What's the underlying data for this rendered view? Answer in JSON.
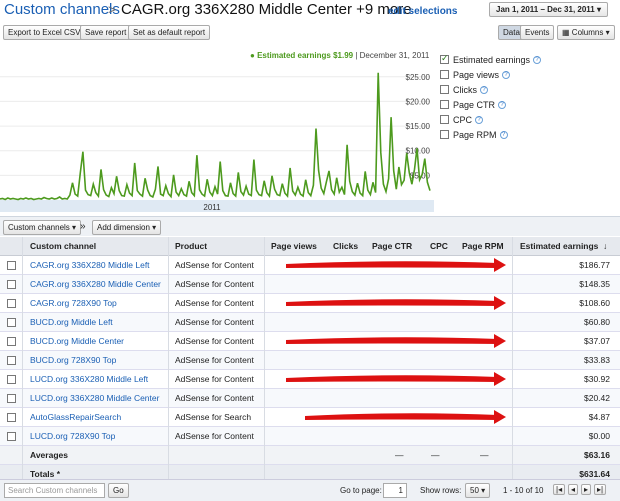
{
  "breadcrumb": {
    "parent": "Custom channels",
    "separator": ">",
    "current": "CAGR.org 336X280 Middle Center +9 more",
    "edit": "edit selections"
  },
  "date_range": "Jan 1, 2011 – Dec 31, 2011",
  "toolbar": {
    "export": "Export to Excel CSV",
    "save": "Save report",
    "default": "Set as default report"
  },
  "view_toggle": {
    "data": "Data",
    "events": "Events",
    "columns": "Columns"
  },
  "legend": {
    "series": "Estimated earnings $1.99",
    "date": "December 31, 2011"
  },
  "metrics": [
    {
      "label": "Estimated earnings",
      "checked": true
    },
    {
      "label": "Page views",
      "checked": false
    },
    {
      "label": "Clicks",
      "checked": false
    },
    {
      "label": "Page CTR",
      "checked": false
    },
    {
      "label": "CPC",
      "checked": false
    },
    {
      "label": "Page RPM",
      "checked": false
    }
  ],
  "chart_data": {
    "type": "line",
    "xlabel": "2011",
    "y_ticks": [
      "$25.00",
      "$20.00",
      "$15.00",
      "$10.00",
      "$5.00"
    ],
    "ylim": [
      0,
      28
    ],
    "series_color": "#4d9a1e",
    "values": [
      0.2,
      0.3,
      0.1,
      0.4,
      0.2,
      0.3,
      0.2,
      0.1,
      0.3,
      0.2,
      0.4,
      0.2,
      0.3,
      0.1,
      0.2,
      0.3,
      0.2,
      0.5,
      0.3,
      0.2,
      0.4,
      0.2,
      0.3,
      0.6,
      0.2,
      0.3,
      0.2,
      1.0,
      3.5,
      1.2,
      0.8,
      5.5,
      9.8,
      2.0,
      1.1,
      0.9,
      3.2,
      1.5,
      0.8,
      6.2,
      2.1,
      1.0,
      0.7,
      2.5,
      1.3,
      4.8,
      1.9,
      0.9,
      0.8,
      3.1,
      1.4,
      0.9,
      7.5,
      1.9,
      1.2,
      0.8,
      4.4,
      2.0,
      0.9,
      0.6,
      2.2,
      6.8,
      1.2,
      0.9,
      2.9,
      1.3,
      0.7,
      5.1,
      1.6,
      0.9,
      2.3,
      1.1,
      0.8,
      3.8,
      1.5,
      0.9,
      9.1,
      2.1,
      1.2,
      0.8,
      4.2,
      1.6,
      0.9,
      2.7,
      1.2,
      7.8,
      1.9,
      0.9,
      0.8,
      3.5,
      1.3,
      0.8,
      5.6,
      1.7,
      1.0,
      2.8,
      1.2,
      0.9,
      8.2,
      2.0,
      1.1,
      0.9,
      3.9,
      1.5,
      0.8,
      4.9,
      2.2,
      1.1,
      0.9,
      3.3,
      1.4,
      0.8,
      6.5,
      1.8,
      1.0,
      2.6,
      1.2,
      0.8,
      4.1,
      1.5,
      0.9,
      3.0,
      14.5,
      6.0,
      2.4,
      1.3,
      3.7,
      5.9,
      2.1,
      1.2,
      4.5,
      1.6,
      2.6,
      1.1,
      11.2,
      3.8,
      1.7,
      1.0,
      3.4,
      1.4,
      0.9,
      5.8,
      2.0,
      1.1,
      3.6,
      1.5,
      25.8,
      9.6,
      3.2,
      1.7,
      4.3,
      16.8,
      5.9,
      2.2,
      6.7,
      3.1,
      4.0,
      9.5,
      5.5,
      3.2,
      6.2,
      10.5,
      4.1,
      5.2,
      8.4,
      3.6,
      1.9
    ]
  },
  "dimension_bar": {
    "dimension": "Custom channels",
    "chevrons": "»",
    "add": "Add dimension"
  },
  "table": {
    "headers": [
      "Custom channel",
      "Product",
      "Page views",
      "Clicks",
      "Page CTR",
      "CPC",
      "Page RPM",
      "Estimated earnings"
    ],
    "rows": [
      {
        "channel": "CAGR.org 336X280 Middle Left",
        "product": "AdSense for Content",
        "earnings": "$186.77"
      },
      {
        "channel": "CAGR.org 336X280 Middle Center",
        "product": "AdSense for Content",
        "earnings": "$148.35"
      },
      {
        "channel": "CAGR.org 728X90 Top",
        "product": "AdSense for Content",
        "earnings": "$108.60"
      },
      {
        "channel": "BUCD.org Middle Left",
        "product": "AdSense for Content",
        "earnings": "$60.80"
      },
      {
        "channel": "BUCD.org Middle Center",
        "product": "AdSense for Content",
        "earnings": "$37.07"
      },
      {
        "channel": "BUCD.org 728X90 Top",
        "product": "AdSense for Content",
        "earnings": "$33.83"
      },
      {
        "channel": "LUCD.org 336X280 Middle Left",
        "product": "AdSense for Content",
        "earnings": "$30.92"
      },
      {
        "channel": "LUCD.org 336X280 Middle Center",
        "product": "AdSense for Content",
        "earnings": "$20.42"
      },
      {
        "channel": "AutoGlassRepairSearch",
        "product": "AdSense for Search",
        "earnings": "$4.87"
      },
      {
        "channel": "LUCD.org 728X90 Top",
        "product": "AdSense for Content",
        "earnings": "$0.00"
      }
    ],
    "averages": {
      "label": "Averages",
      "dashes": [
        "—",
        "—",
        "—"
      ],
      "earnings": "$63.16"
    },
    "totals": {
      "label": "Totals *",
      "earnings": "$631.64"
    }
  },
  "footer": {
    "search_placeholder": "Search Custom channels",
    "go": "Go",
    "goto_label": "Go to page:",
    "page_value": "1",
    "rows_label": "Show rows:",
    "rows_value": "50",
    "range": "1 - 10 of 10"
  },
  "redaction_color": "#dd1111"
}
